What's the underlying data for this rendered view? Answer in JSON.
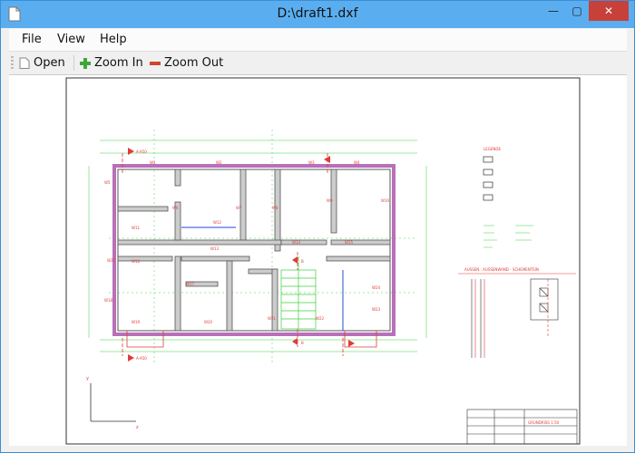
{
  "window": {
    "title": "D:\\draft1.dxf",
    "minimize_glyph": "—",
    "maximize_glyph": "▢",
    "close_glyph": "✕"
  },
  "menu": {
    "items": [
      "File",
      "View",
      "Help"
    ]
  },
  "toolbar": {
    "open_label": "Open",
    "zoom_in_label": "Zoom In",
    "zoom_out_label": "Zoom Out"
  },
  "drawing": {
    "section_marks": [
      "A-A50",
      "A-A50",
      "B",
      "B"
    ],
    "room_labels": [
      "W1",
      "W2",
      "W3",
      "W4",
      "W5",
      "W6",
      "W7",
      "W8",
      "W9",
      "W10",
      "W11",
      "W12",
      "W13",
      "W14",
      "W15",
      "W16",
      "W17",
      "W18",
      "W19",
      "W20",
      "W21",
      "W22",
      "W23",
      "W24",
      "W25"
    ],
    "legend_title": "LEGENDE",
    "legend_items": [
      "",
      "",
      "",
      ""
    ],
    "detail_title": "AUSSEN.: AUSSENWAND - SCHEMENTEIN",
    "titleblock_text": "GRUNDRISS 1:50",
    "axis_y": "y",
    "axis_x": "z"
  }
}
